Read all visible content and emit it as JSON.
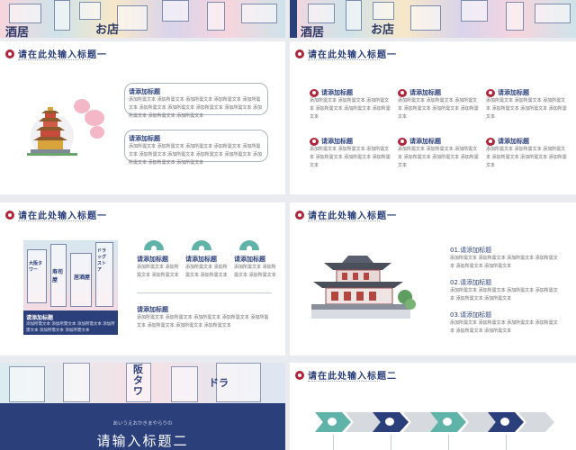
{
  "header_slides": {
    "left_signs": [
      "酒居",
      "お店"
    ],
    "right_signs": [
      "酒居",
      "お店"
    ]
  },
  "slide_title": "请在此处输入标题一",
  "slide_title_2": "请在此处输入标题二",
  "item_heading": "请添加标题",
  "item_body": "添加所需文本 添加所需文本 添加所需文本 添加所需文本 添加所需文本 添加所需文本",
  "short_body": "添加所需文本 添加所需文本 添加所需文本",
  "slide1": {
    "boxes": [
      {
        "heading": "请添加标题",
        "body": "添加所需文本 添加所需文本 添加所需文本 添加所需文本 添加所需文本 添加所需文本 添加所需文本 添加所需文本 添加所需文本 添加所需文本 添加所需文本 添加所需文本"
      },
      {
        "heading": "请添加标题",
        "body": "添加所需文本 添加所需文本 添加所需文本 添加所需文本 添加所需文本 添加所需文本 添加所需文本 添加所需文本 添加所需文本 添加所需文本 添加所需文本 添加所需文本"
      }
    ]
  },
  "slide2": {
    "items": [
      {
        "heading": "请添加标题",
        "body": "添加所需文本 添加所需文本 添加所需文本 添加所需文本 添加所需文本 添加所需文本"
      },
      {
        "heading": "请添加标题",
        "body": "添加所需文本 添加所需文本 添加所需文本 添加所需文本 添加所需文本 添加所需文本"
      },
      {
        "heading": "请添加标题",
        "body": "添加所需文本 添加所需文本 添加所需文本 添加所需文本 添加所需文本 添加所需文本"
      },
      {
        "heading": "请添加标题",
        "body": "添加所需文本 添加所需文本 添加所需文本 添加所需文本 添加所需文本 添加所需文本"
      },
      {
        "heading": "请添加标题",
        "body": "添加所需文本 添加所需文本 添加所需文本 添加所需文本 添加所需文本 添加所需文本"
      },
      {
        "heading": "请添加标题",
        "body": "添加所需文本 添加所需文本 添加所需文本 添加所需文本 添加所需文本 添加所需文本"
      }
    ]
  },
  "slide3": {
    "street_signs": [
      "大阪タワー",
      "寿司屋",
      "居酒屋",
      "ドラッグストア"
    ],
    "navy_heading": "请添加标题",
    "navy_body": "添加所需文本 添加所需文本 添加所需文本 添加所需文本 添加所需文本 添加所需文本",
    "cols": [
      {
        "heading": "请添加标题",
        "body": "添加所需文本 添加所需文本 添加所需文本"
      },
      {
        "heading": "请添加标题",
        "body": "添加所需文本 添加所需文本 添加所需文本"
      },
      {
        "heading": "请添加标题",
        "body": "添加所需文本 添加所需文本 添加所需文本"
      }
    ],
    "bottom_heading": "请添加标题",
    "bottom_body": "添加所需文本 添加所需文本 添加所需文本 添加所需文本 添加所需文本 添加所需文本 添加所需文本 添加所需文本"
  },
  "slide4": {
    "items": [
      {
        "heading": "01.请添加标题",
        "body": "添加所需文本 添加所需文本 添加所需文本 添加所需文本 添加所需文本 添加所需文本"
      },
      {
        "heading": "02.请添加标题",
        "body": "添加所需文本 添加所需文本 添加所需文本 添加所需文本 添加所需文本 添加所需文本"
      },
      {
        "heading": "03.请添加标题",
        "body": "添加所需文本 添加所需文本 添加所需文本 添加所需文本 添加所需文本 添加所需文本"
      }
    ]
  },
  "slide5": {
    "art_signs": [
      "阪タワ",
      "ドラ"
    ],
    "jp_line": "あいうえおかきまやらりの",
    "big_title": "请输入标题二"
  },
  "colors": {
    "navy": "#2b3f7a",
    "crimson": "#b0253b",
    "teal": "#5fb3a9",
    "grey_arrow": "#d6d9de"
  }
}
